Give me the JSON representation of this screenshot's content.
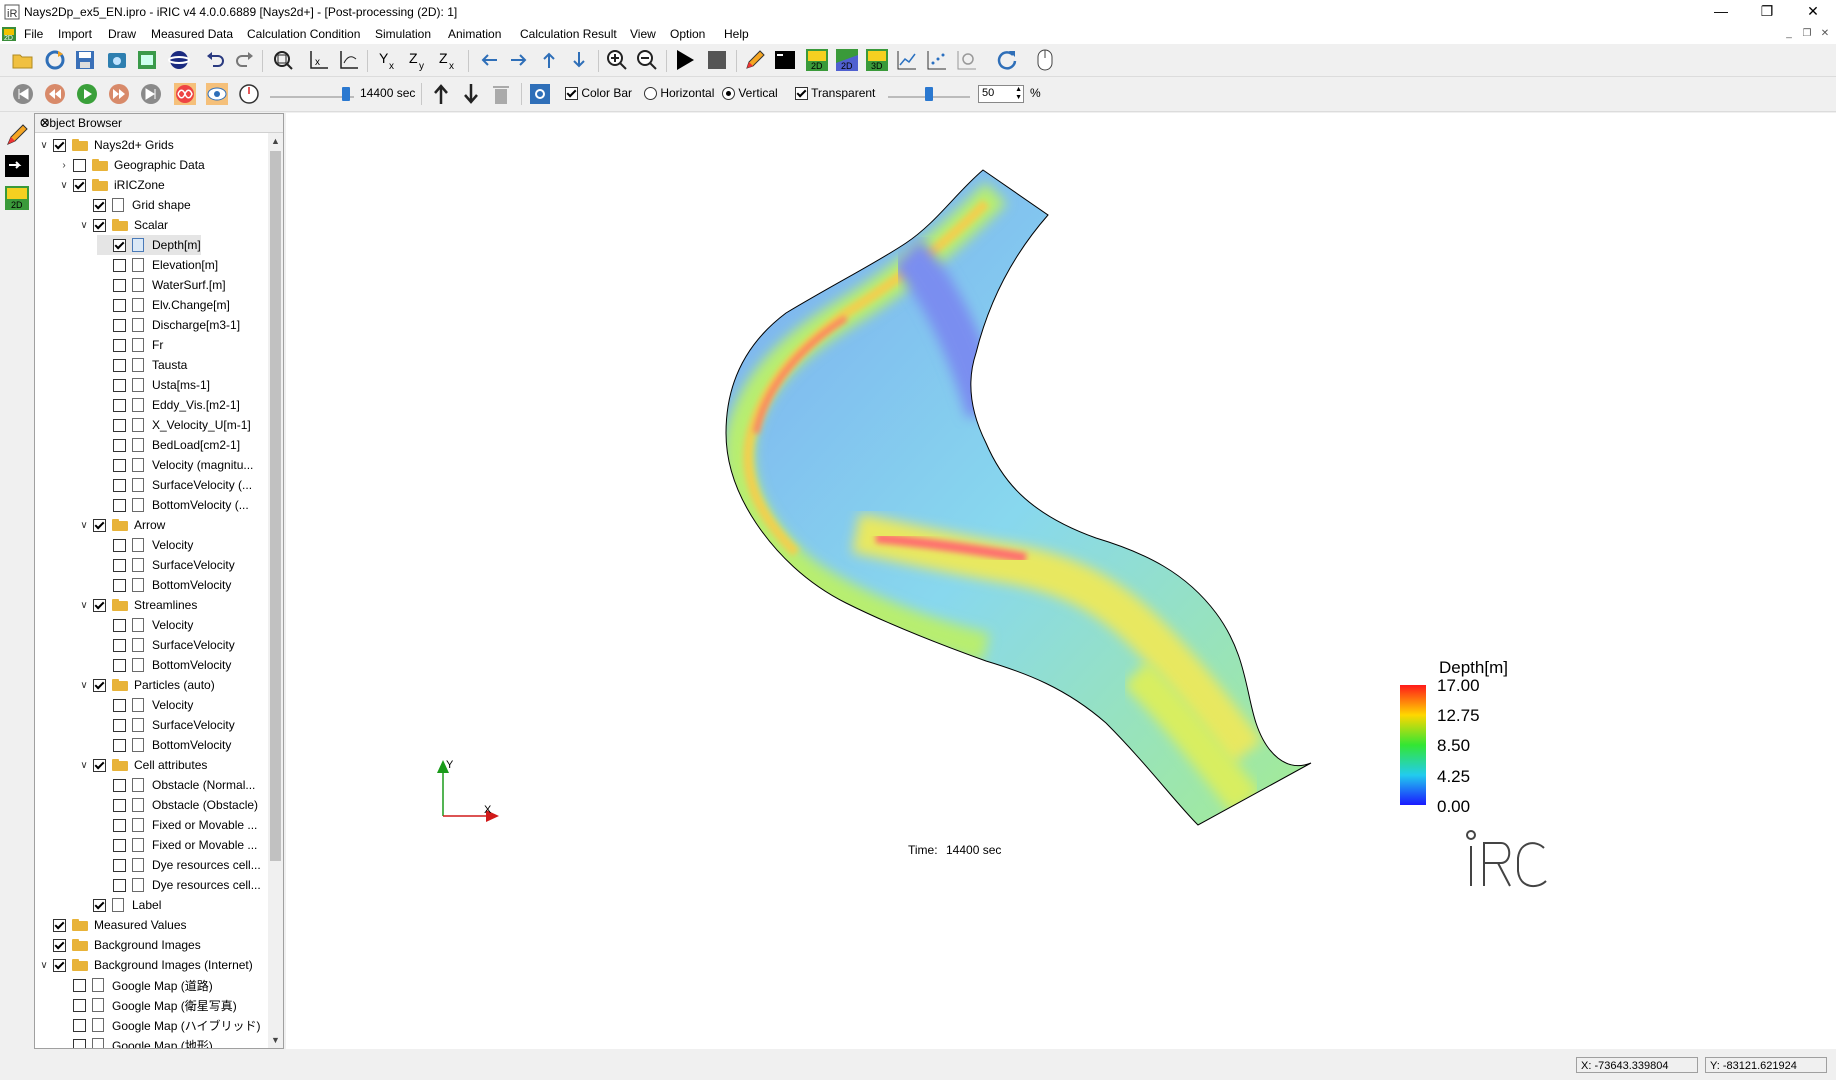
{
  "window": {
    "title": "Nays2Dp_ex5_EN.ipro - iRIC v4 4.0.0.6889 [Nays2d+] - [Post-processing (2D): 1]"
  },
  "menu": [
    "File",
    "Import",
    "Draw",
    "Measured Data",
    "Calculation Condition",
    "Simulation",
    "Animation",
    "Calculation Result",
    "View",
    "Option",
    "Help"
  ],
  "toolbar2": {
    "time_value": "14400 sec",
    "colorbar_label": "Color Bar",
    "horizontal_label": "Horizontal",
    "vertical_label": "Vertical",
    "transparent_label": "Transparent",
    "opacity_value": "50",
    "percent": "%"
  },
  "object_browser": {
    "title": "Object Browser",
    "items": [
      {
        "label": "Nays2d+ Grids",
        "level": 0,
        "expand": "v",
        "checked": true,
        "icon": "folder"
      },
      {
        "label": "Geographic Data",
        "level": 1,
        "expand": ">",
        "checked": false,
        "icon": "folder"
      },
      {
        "label": "iRICZone",
        "level": 1,
        "expand": "v",
        "checked": true,
        "icon": "folder"
      },
      {
        "label": "Grid shape",
        "level": 2,
        "expand": "",
        "checked": true,
        "icon": "doc"
      },
      {
        "label": "Scalar",
        "level": 2,
        "expand": "v",
        "checked": true,
        "icon": "folder"
      },
      {
        "label": "Depth[m]",
        "level": 3,
        "expand": "",
        "checked": true,
        "icon": "doc-blue",
        "selected": true
      },
      {
        "label": "Elevation[m]",
        "level": 3,
        "expand": "",
        "checked": false,
        "icon": "doc"
      },
      {
        "label": "WaterSurf.[m]",
        "level": 3,
        "expand": "",
        "checked": false,
        "icon": "doc"
      },
      {
        "label": "Elv.Change[m]",
        "level": 3,
        "expand": "",
        "checked": false,
        "icon": "doc"
      },
      {
        "label": "Discharge[m3-1]",
        "level": 3,
        "expand": "",
        "checked": false,
        "icon": "doc"
      },
      {
        "label": "Fr",
        "level": 3,
        "expand": "",
        "checked": false,
        "icon": "doc"
      },
      {
        "label": "Tausta",
        "level": 3,
        "expand": "",
        "checked": false,
        "icon": "doc"
      },
      {
        "label": "Usta[ms-1]",
        "level": 3,
        "expand": "",
        "checked": false,
        "icon": "doc"
      },
      {
        "label": "Eddy_Vis.[m2-1]",
        "level": 3,
        "expand": "",
        "checked": false,
        "icon": "doc"
      },
      {
        "label": "X_Velocity_U[m-1]",
        "level": 3,
        "expand": "",
        "checked": false,
        "icon": "doc"
      },
      {
        "label": "BedLoad[cm2-1]",
        "level": 3,
        "expand": "",
        "checked": false,
        "icon": "doc"
      },
      {
        "label": "Velocity (magnitu...",
        "level": 3,
        "expand": "",
        "checked": false,
        "icon": "doc"
      },
      {
        "label": "SurfaceVelocity (...",
        "level": 3,
        "expand": "",
        "checked": false,
        "icon": "doc"
      },
      {
        "label": "BottomVelocity (...",
        "level": 3,
        "expand": "",
        "checked": false,
        "icon": "doc"
      },
      {
        "label": "Arrow",
        "level": 2,
        "expand": "v",
        "checked": true,
        "icon": "folder"
      },
      {
        "label": "Velocity",
        "level": 3,
        "expand": "",
        "checked": false,
        "icon": "doc"
      },
      {
        "label": "SurfaceVelocity",
        "level": 3,
        "expand": "",
        "checked": false,
        "icon": "doc"
      },
      {
        "label": "BottomVelocity",
        "level": 3,
        "expand": "",
        "checked": false,
        "icon": "doc"
      },
      {
        "label": "Streamlines",
        "level": 2,
        "expand": "v",
        "checked": true,
        "icon": "folder"
      },
      {
        "label": "Velocity",
        "level": 3,
        "expand": "",
        "checked": false,
        "icon": "doc"
      },
      {
        "label": "SurfaceVelocity",
        "level": 3,
        "expand": "",
        "checked": false,
        "icon": "doc"
      },
      {
        "label": "BottomVelocity",
        "level": 3,
        "expand": "",
        "checked": false,
        "icon": "doc"
      },
      {
        "label": "Particles (auto)",
        "level": 2,
        "expand": "v",
        "checked": true,
        "icon": "folder"
      },
      {
        "label": "Velocity",
        "level": 3,
        "expand": "",
        "checked": false,
        "icon": "doc"
      },
      {
        "label": "SurfaceVelocity",
        "level": 3,
        "expand": "",
        "checked": false,
        "icon": "doc"
      },
      {
        "label": "BottomVelocity",
        "level": 3,
        "expand": "",
        "checked": false,
        "icon": "doc"
      },
      {
        "label": "Cell attributes",
        "level": 2,
        "expand": "v",
        "checked": true,
        "icon": "folder"
      },
      {
        "label": "Obstacle (Normal...",
        "level": 3,
        "expand": "",
        "checked": false,
        "icon": "doc"
      },
      {
        "label": "Obstacle (Obstacle)",
        "level": 3,
        "expand": "",
        "checked": false,
        "icon": "doc"
      },
      {
        "label": "Fixed or Movable ...",
        "level": 3,
        "expand": "",
        "checked": false,
        "icon": "doc"
      },
      {
        "label": "Fixed or Movable ...",
        "level": 3,
        "expand": "",
        "checked": false,
        "icon": "doc"
      },
      {
        "label": "Dye resources cell...",
        "level": 3,
        "expand": "",
        "checked": false,
        "icon": "doc"
      },
      {
        "label": "Dye resources cell...",
        "level": 3,
        "expand": "",
        "checked": false,
        "icon": "doc"
      },
      {
        "label": "Label",
        "level": 2,
        "expand": "",
        "checked": true,
        "icon": "doc"
      },
      {
        "label": "Measured Values",
        "level": 0,
        "expand": "",
        "checked": true,
        "icon": "folder"
      },
      {
        "label": "Background Images",
        "level": 0,
        "expand": "",
        "checked": true,
        "icon": "folder"
      },
      {
        "label": "Background Images (Internet)",
        "level": 0,
        "expand": "v",
        "checked": true,
        "icon": "folder"
      },
      {
        "label": "Google Map (道路)",
        "level": 1,
        "expand": "",
        "checked": false,
        "icon": "doc"
      },
      {
        "label": "Google Map (衛星写真)",
        "level": 1,
        "expand": "",
        "checked": false,
        "icon": "doc"
      },
      {
        "label": "Google Map (ハイブリッド)",
        "level": 1,
        "expand": "",
        "checked": false,
        "icon": "doc"
      },
      {
        "label": "Google Map (地形)",
        "level": 1,
        "expand": "",
        "checked": false,
        "icon": "doc"
      }
    ]
  },
  "viewport": {
    "time_label": "Time:",
    "time_value": "14400 sec",
    "axis_y": "Y",
    "axis_x": "X",
    "colorbar": {
      "title": "Depth[m]",
      "ticks": [
        "17.00",
        "12.75",
        "8.50",
        "4.25",
        "0.00"
      ]
    },
    "logo_text": "iRIC"
  },
  "status": {
    "x": "X: -73643.339804",
    "y": "Y: -83121.621924"
  }
}
